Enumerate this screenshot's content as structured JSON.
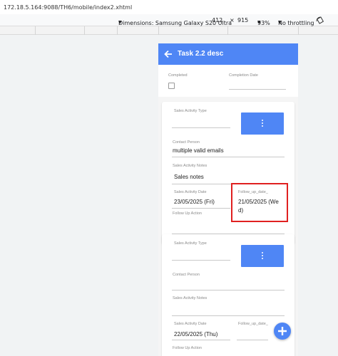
{
  "browser": {
    "url": "172.18.5.164:9088/TH6/mobile/index2.xhtml",
    "device_toolbar": {
      "dimensions_label": "Dimensions: Samsung Galaxy S20 Ultra",
      "width": "412",
      "times": "×",
      "height": "915",
      "zoom": "93%",
      "throttling": "No throttling"
    }
  },
  "app": {
    "title": "Task 2.2 desc",
    "accent_color": "#4f86f5",
    "top_card": {
      "completed_label": "Completed",
      "completion_date_label": "Completion Date",
      "completed_checked": false
    },
    "activities": [
      {
        "sales_activity_type_label": "Sales Activity Type",
        "contact_person_label": "Contact Person",
        "contact_person_value": "multiple valid emails",
        "notes_label": "Sales Activity Notes",
        "notes_value": "Sales notes",
        "date_label": "Sales Activity Date",
        "date_value": "23/05/2025 (Fri)",
        "follow_up_date_label": "Follow_up_date_",
        "follow_up_date_line1": "21/05/2025 (We",
        "follow_up_date_line2": "d)",
        "follow_up_action_label": "Follow Up Action"
      },
      {
        "sales_activity_type_label": "Sales Activity Type",
        "contact_person_label": "Contact Person",
        "notes_label": "Sales Activity Notes",
        "date_label": "Sales Activity Date",
        "date_value": "22/05/2025 (Thu)",
        "follow_up_date_label": "Follow_up_date_",
        "follow_up_action_label": "Follow Up Action"
      }
    ],
    "highlight_color": "#e02020"
  }
}
